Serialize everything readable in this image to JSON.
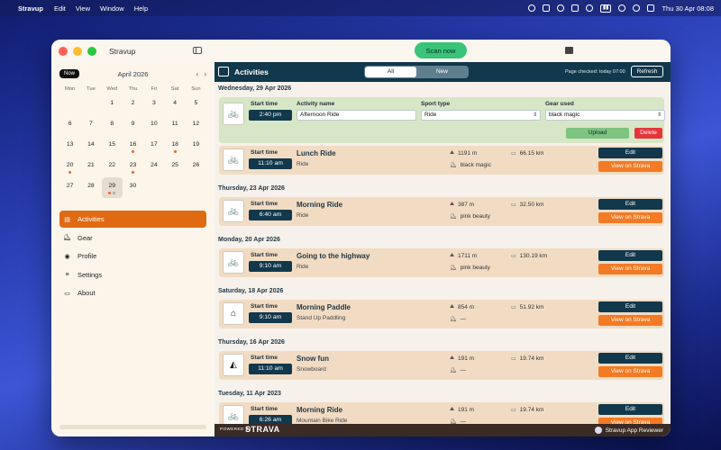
{
  "menubar": {
    "app_name": "Stravup",
    "items": [
      "Edit",
      "View",
      "Window",
      "Help"
    ],
    "datetime": "Thu 30 Apr  08:08"
  },
  "window": {
    "title": "Stravup",
    "scan_label": "Scan now"
  },
  "calendar": {
    "now_label": "Now",
    "month": "April 2026",
    "weekdays": [
      "Mon",
      "Tue",
      "Wed",
      "Thu",
      "Fri",
      "Sat",
      "Sun"
    ],
    "days": [
      {
        "d": ""
      },
      {
        "d": ""
      },
      {
        "d": "1"
      },
      {
        "d": "2"
      },
      {
        "d": "3"
      },
      {
        "d": "4"
      },
      {
        "d": "5"
      },
      {
        "d": "6"
      },
      {
        "d": "7"
      },
      {
        "d": "8"
      },
      {
        "d": "9"
      },
      {
        "d": "10"
      },
      {
        "d": "11"
      },
      {
        "d": "12"
      },
      {
        "d": "13"
      },
      {
        "d": "14"
      },
      {
        "d": "15"
      },
      {
        "d": "16",
        "dots": [
          "orange"
        ]
      },
      {
        "d": "17"
      },
      {
        "d": "18",
        "dots": [
          "orange"
        ]
      },
      {
        "d": "19"
      },
      {
        "d": "20",
        "dots": [
          "orange"
        ]
      },
      {
        "d": "21"
      },
      {
        "d": "22"
      },
      {
        "d": "23",
        "dots": [
          "orange"
        ]
      },
      {
        "d": "24"
      },
      {
        "d": "25"
      },
      {
        "d": "26"
      },
      {
        "d": "27"
      },
      {
        "d": "28"
      },
      {
        "d": "29",
        "today": true,
        "dots": [
          "orange",
          "grey"
        ]
      },
      {
        "d": "30"
      },
      {
        "d": ""
      },
      {
        "d": ""
      },
      {
        "d": ""
      }
    ]
  },
  "nav": [
    {
      "label": "Activities",
      "icon": "activities-icon",
      "active": true
    },
    {
      "label": "Gear",
      "icon": "shoe-icon"
    },
    {
      "label": "Profile",
      "icon": "person-icon"
    },
    {
      "label": "Settings",
      "icon": "sliders-icon"
    },
    {
      "label": "About",
      "icon": "id-card-icon"
    }
  ],
  "main": {
    "title": "Activities",
    "tabs": [
      "All",
      "New"
    ],
    "page_checked": "Page checked: today 07:00",
    "refresh_label": "Refresh"
  },
  "new_activity": {
    "date": "Wednesday, 29 Apr 2026",
    "start_time_label": "Start time",
    "start_time": "2:40 pm",
    "name_label": "Activity name",
    "name_value": "Afternoon Ride",
    "sport_label": "Sport type",
    "sport_value": "Ride",
    "gear_label": "Gear used",
    "gear_value": "black magic",
    "upload_label": "Upload",
    "delete_label": "Delete"
  },
  "activities": [
    {
      "date": "",
      "start_label": "Start time",
      "time": "11:10 am",
      "name": "Lunch Ride",
      "sport": "Ride",
      "elev": "1191 m",
      "dist": "66.15 km",
      "gear": "black magic",
      "edit": "Edit",
      "view": "View on Strava",
      "icon": "bike-icon"
    },
    {
      "date": "Thursday, 23 Apr 2026",
      "start_label": "Start time",
      "time": "6:40 am",
      "name": "Morning Ride",
      "sport": "Ride",
      "elev": "387 m",
      "dist": "32.50 km",
      "gear": "pink beauty",
      "edit": "Edit",
      "view": "View on Strava",
      "icon": "bike-icon"
    },
    {
      "date": "Monday, 20 Apr 2026",
      "start_label": "Start time",
      "time": "9:10 am",
      "name": "Going to the highway",
      "sport": "Ride",
      "elev": "1711 m",
      "dist": "130.19 km",
      "gear": "pink beauty",
      "edit": "Edit",
      "view": "View on Strava",
      "icon": "bike-icon"
    },
    {
      "date": "Saturday, 18 Apr 2026",
      "start_label": "Start time",
      "time": "9:10 am",
      "name": "Morning Paddle",
      "sport": "Stand Up Paddling",
      "elev": "854 m",
      "dist": "51.92 km",
      "gear": "—",
      "edit": "Edit",
      "view": "View on Strava",
      "icon": "paddle-icon"
    },
    {
      "date": "Thursday, 16 Apr 2026",
      "start_label": "Start time",
      "time": "11:10 am",
      "name": "Snow fun",
      "sport": "Snowboard",
      "elev": "191 m",
      "dist": "19.74 km",
      "gear": "—",
      "edit": "Edit",
      "view": "View on Strava",
      "icon": "snowboard-icon"
    },
    {
      "date": "Tuesday, 11 Apr 2023",
      "start_label": "Start time",
      "time": "6:26 am",
      "name": "Morning Ride",
      "sport": "Mountain Bike Ride",
      "elev": "191 m",
      "dist": "19.74 km",
      "gear": "—",
      "edit": "Edit",
      "view": "View on Strava",
      "icon": "mtb-icon"
    }
  ],
  "footer": {
    "powered_by": "POWERED BY",
    "brand": "STRAVA",
    "reviewer": "Stravup App Reviewer"
  }
}
